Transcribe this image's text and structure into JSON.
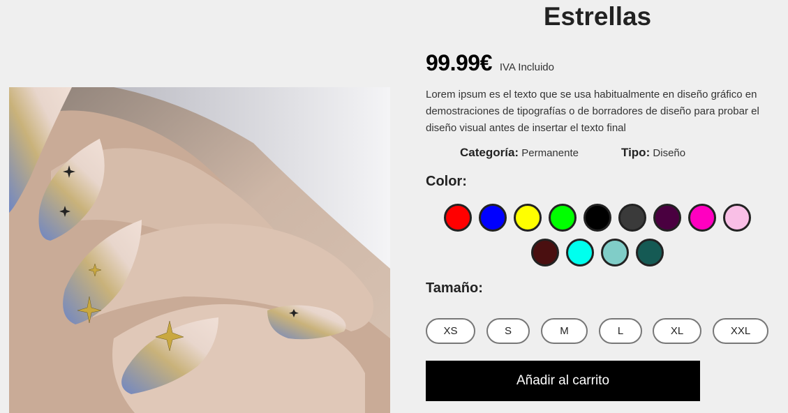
{
  "product": {
    "title": "Estrellas",
    "price": "99.99€",
    "tax_note": "IVA Incluido",
    "description": "Lorem ipsum es el texto que se usa habitualmente en diseño gráfico en demostraciones de tipografías o de borradores de diseño para probar el diseño visual antes de insertar el texto final",
    "category_label": "Categoría:",
    "category_value": "Permanente",
    "type_label": "Tipo:",
    "type_value": "Diseño"
  },
  "color_section": {
    "label": "Color:",
    "swatches": [
      "#ff0000",
      "#0000ff",
      "#ffff00",
      "#00ff00",
      "#000000",
      "#3a3a3a",
      "#4a0040",
      "#ff00c0",
      "#f9bfe6",
      "#4a0f10",
      "#00ffee",
      "#80cdc8",
      "#155a54"
    ]
  },
  "size_section": {
    "label": "Tamaño:",
    "sizes": [
      "XS",
      "S",
      "M",
      "L",
      "XL",
      "XXL"
    ]
  },
  "cart_button_label": "Añadir al carrito"
}
